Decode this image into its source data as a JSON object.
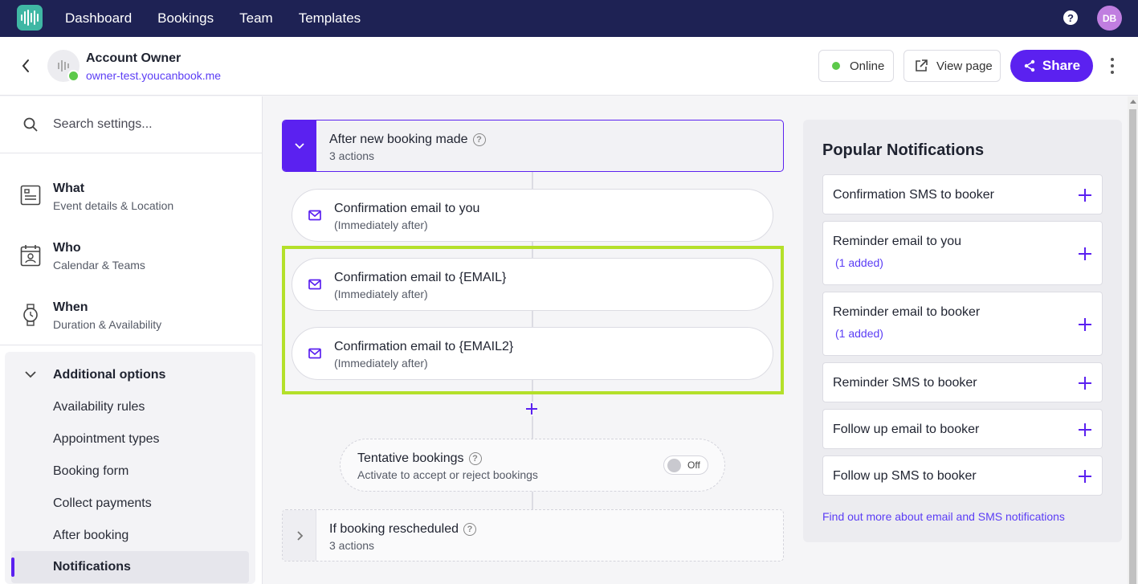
{
  "nav": {
    "links": [
      "Dashboard",
      "Bookings",
      "Team",
      "Templates"
    ],
    "help_label": "?",
    "avatar_initials": "DB"
  },
  "header": {
    "account_name": "Account Owner",
    "account_url": "owner-test.youcanbook.me",
    "online_label": "Online",
    "view_page_label": "View page",
    "share_label": "Share"
  },
  "sidebar": {
    "search_placeholder": "Search settings...",
    "items": [
      {
        "title": "What",
        "subtitle": "Event details & Location"
      },
      {
        "title": "Who",
        "subtitle": "Calendar & Teams"
      },
      {
        "title": "When",
        "subtitle": "Duration & Availability"
      }
    ],
    "additional": {
      "title": "Additional options",
      "subitems": [
        "Availability rules",
        "Appointment types",
        "Booking form",
        "Collect payments",
        "After booking",
        "Notifications"
      ],
      "active": "Notifications"
    }
  },
  "workflow": {
    "new_booking": {
      "title": "After new booking made",
      "subtitle": "3 actions"
    },
    "actions": [
      {
        "title": "Confirmation email to you",
        "timing": "(Immediately after)"
      },
      {
        "title": "Confirmation email to {EMAIL}",
        "timing": "(Immediately after)"
      },
      {
        "title": "Confirmation email to {EMAIL2}",
        "timing": "(Immediately after)"
      }
    ],
    "tentative": {
      "title": "Tentative bookings",
      "subtitle": "Activate to accept or reject bookings",
      "toggle_label": "Off"
    },
    "rescheduled": {
      "title": "If booking rescheduled",
      "subtitle": "3 actions"
    }
  },
  "popular": {
    "title": "Popular Notifications",
    "items": [
      {
        "title": "Confirmation SMS to booker",
        "added": ""
      },
      {
        "title": "Reminder email to you",
        "added": "(1 added)"
      },
      {
        "title": "Reminder email to booker",
        "added": "(1 added)"
      },
      {
        "title": "Reminder SMS to booker",
        "added": ""
      },
      {
        "title": "Follow up email to booker",
        "added": ""
      },
      {
        "title": "Follow up SMS to booker",
        "added": ""
      }
    ],
    "link": "Find out more about email and SMS notifications"
  },
  "colors": {
    "nav_bg": "#1e2254",
    "accent": "#5b21f0",
    "link": "#5b3df5",
    "online": "#5cc94a",
    "highlight": "#b4e02a"
  }
}
